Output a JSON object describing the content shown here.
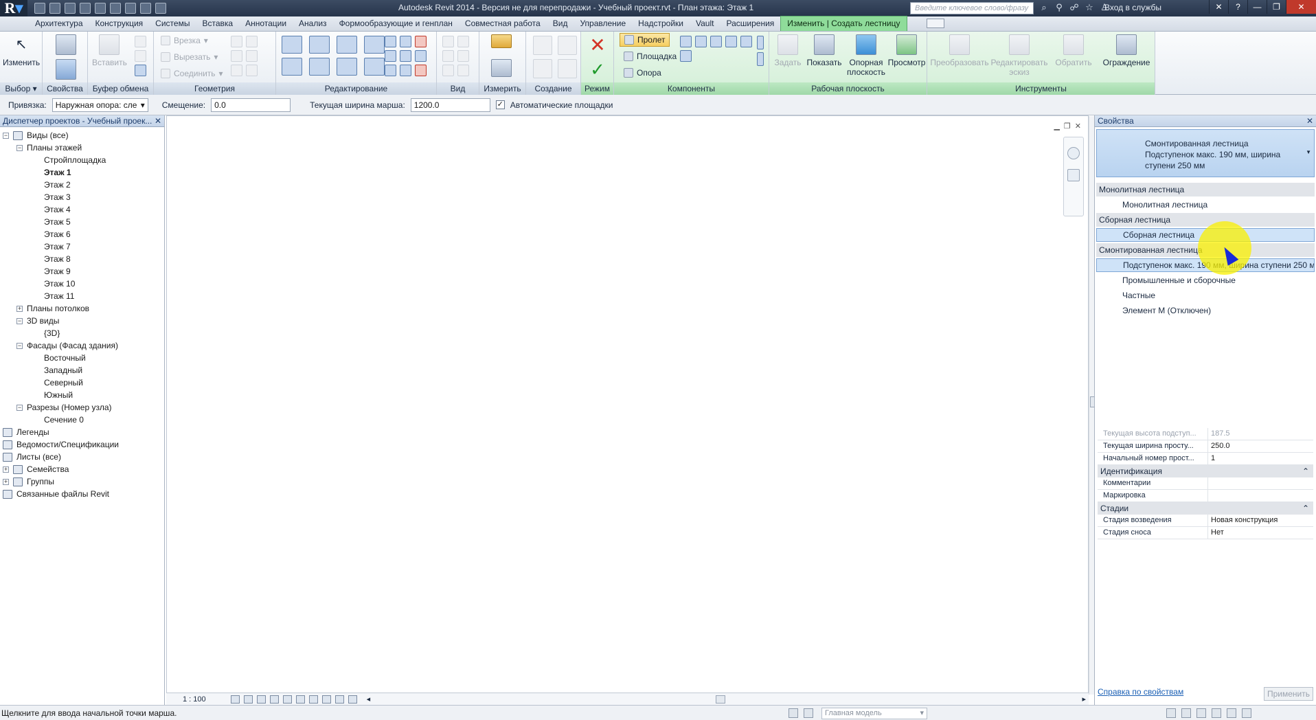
{
  "titlebar": {
    "title": "Autodesk Revit 2014 - Версия не для перепродажи -   Учебный проект.rvt - План этажа: Этаж 1",
    "search_placeholder": "Введите ключевое слово/фразу",
    "login": "Вход в службы"
  },
  "ribbon_tabs": [
    "Архитектура",
    "Конструкция",
    "Системы",
    "Вставка",
    "Аннотации",
    "Анализ",
    "Формообразующие и генплан",
    "Совместная работа",
    "Вид",
    "Управление",
    "Надстройки",
    "Vault",
    "Расширения",
    "Изменить | Создать лестницу"
  ],
  "ribbon": {
    "select": {
      "modify": "Изменить",
      "label": "Выбор"
    },
    "properties": {
      "label": "Свойства"
    },
    "clipboard": {
      "paste": "Вставить",
      "label": "Буфер обмена"
    },
    "geometry": {
      "cut": "Врезка",
      "cutout": "Вырезать",
      "join": "Соединить",
      "label": "Геометрия"
    },
    "modify_panel": {
      "label": "Редактирование"
    },
    "view": {
      "label": "Вид"
    },
    "measure": {
      "label": "Измерить"
    },
    "create": {
      "label": "Создание"
    },
    "mode": {
      "label": "Режим"
    },
    "components": {
      "run": "Пролет",
      "landing": "Площадка",
      "support": "Опора",
      "label": "Компоненты"
    },
    "workplane": {
      "set": "Задать",
      "show": "Показать",
      "ref_plane_1": "Опорная",
      "ref_plane_2": "плоскость",
      "viewer": "Просмотр",
      "label": "Рабочая плоскость"
    },
    "tools": {
      "convert": "Преобразовать",
      "edit_1": "Редактировать",
      "edit_2": "эскиз",
      "flip": "Обратить",
      "railing": "Ограждение",
      "label": "Инструменты"
    }
  },
  "options_bar": {
    "location_label": "Привязка:",
    "location_value": "Наружная опора: сле",
    "offset_label": "Смещение:",
    "offset_value": "0.0",
    "width_label": "Текущая ширина марша:",
    "width_value": "1200.0",
    "auto_landing_label": "Автоматические площадки",
    "auto_landing_checked": "✓"
  },
  "browser": {
    "title": "Диспетчер проектов - Учебный проек...",
    "close": "✕",
    "rows": [
      {
        "label": "Виды (все)",
        "toggle": "−"
      },
      {
        "label": "Планы этажей",
        "toggle": "−"
      },
      {
        "label": "Стройплощадка"
      },
      {
        "label": "Этаж 1"
      },
      {
        "label": "Этаж 2"
      },
      {
        "label": "Этаж 3"
      },
      {
        "label": "Этаж 4"
      },
      {
        "label": "Этаж 5"
      },
      {
        "label": "Этаж 6"
      },
      {
        "label": "Этаж 7"
      },
      {
        "label": "Этаж 8"
      },
      {
        "label": "Этаж 9"
      },
      {
        "label": "Этаж 10"
      },
      {
        "label": "Этаж 11"
      },
      {
        "label": "Планы потолков",
        "toggle": "+"
      },
      {
        "label": "3D виды",
        "toggle": "−"
      },
      {
        "label": "{3D}"
      },
      {
        "label": "Фасады (Фасад здания)",
        "toggle": "−"
      },
      {
        "label": "Восточный"
      },
      {
        "label": "Западный"
      },
      {
        "label": "Северный"
      },
      {
        "label": "Южный"
      },
      {
        "label": "Разрезы (Номер узла)",
        "toggle": "−"
      },
      {
        "label": "Сечение 0"
      },
      {
        "label": "Легенды"
      },
      {
        "label": "Ведомости/Спецификации"
      },
      {
        "label": "Листы (все)"
      },
      {
        "label": "Семейства",
        "toggle": "+"
      },
      {
        "label": "Группы",
        "toggle": "+"
      },
      {
        "label": "Связанные файлы Revit"
      }
    ]
  },
  "view_bar": {
    "scale": "1 : 100"
  },
  "properties": {
    "title": "Свойства",
    "close": "✕",
    "type_selector": "Смонтированная лестница\nПодступенок макс. 190 мм, ширина ступени 250 мм",
    "type_dropdown": [
      {
        "group": "Монолитная лестница",
        "items": [
          "Монолитная лестница"
        ]
      },
      {
        "group": "Сборная лестница",
        "items": [
          "Сборная лестница"
        ]
      },
      {
        "group": "Смонтированная лестница",
        "items": [
          "Подступенок макс. 190 мм, ширина ступени 250 мм",
          "Промышленные и сборочные",
          "Частные",
          "Элемент М (Отключен)"
        ]
      }
    ],
    "rows_top": [
      {
        "name": "Текущая высота подступ...",
        "value": "187.5",
        "disabled": "true"
      },
      {
        "name": "Текущая ширина просту...",
        "value": "250.0"
      },
      {
        "name": "Начальный номер прост...",
        "value": "1"
      }
    ],
    "sections": [
      {
        "title": "Идентификация",
        "rows": [
          {
            "name": "Комментарии",
            "value": ""
          },
          {
            "name": "Маркировка",
            "value": ""
          }
        ]
      },
      {
        "title": "Стадии",
        "rows": [
          {
            "name": "Стадия возведения",
            "value": "Новая конструкция"
          },
          {
            "name": "Стадия сноса",
            "value": "Нет"
          }
        ]
      }
    ],
    "section_toggle": "⌃",
    "help_link": "Справка по свойствам",
    "apply": "Применить"
  },
  "status": {
    "text": "Щелкните для ввода начальной точки марша.",
    "model": "Главная модель"
  }
}
